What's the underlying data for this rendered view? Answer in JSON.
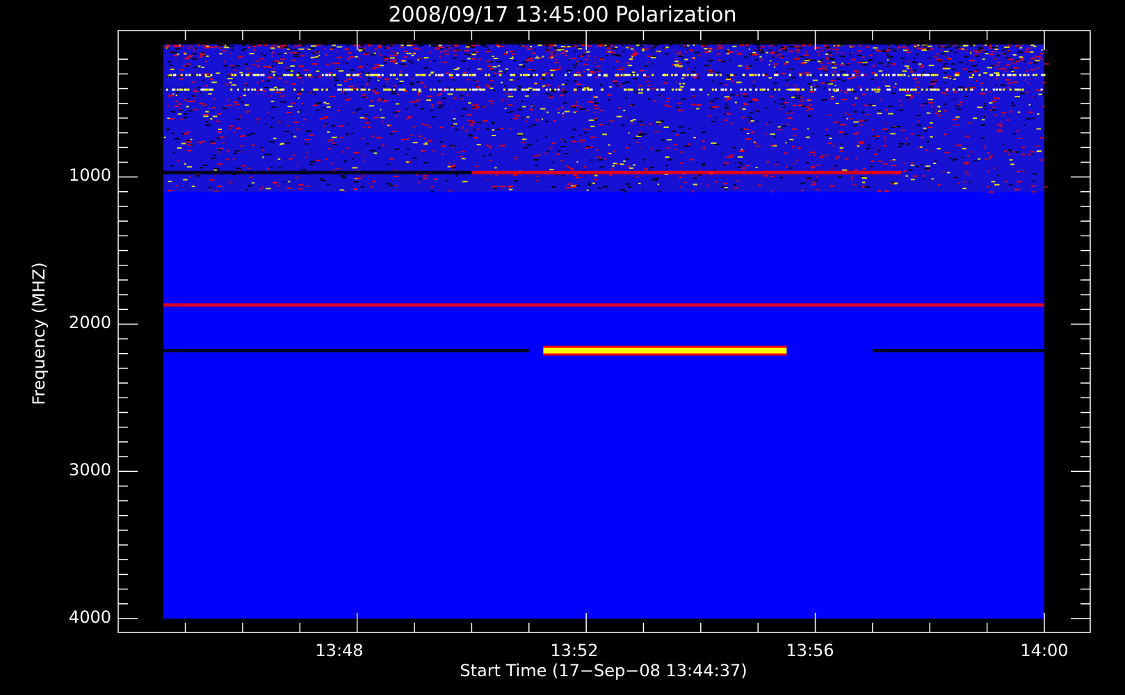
{
  "chart_data": {
    "type": "heatmap",
    "title": "2008/09/17 13:45:00 Polarization",
    "xlabel": "Start Time (17−Sep−08 13:44:37)",
    "ylabel": "Frequency (MHZ)",
    "x_ticks": [
      "13:48",
      "13:52",
      "13:56",
      "14:00"
    ],
    "y_ticks": [
      "1000",
      "2000",
      "3000",
      "4000"
    ],
    "xlim": [
      "13:44:37",
      "14:00:00"
    ],
    "ylim": [
      100,
      4000
    ],
    "y_axis_inverted": true,
    "colormap": {
      "background": "#0000ff",
      "low": "#000000",
      "mid": "#ff0000",
      "high": "#ffff00"
    },
    "features": [
      {
        "label": "noisy band",
        "freq_range": [
          100,
          1100
        ],
        "time_range": [
          "13:44:37",
          "14:00:00"
        ],
        "intensity": "mixed"
      },
      {
        "label": "line",
        "freq": 970,
        "time_range": [
          "13:44:37",
          "13:50:00"
        ],
        "intensity": "low"
      },
      {
        "label": "line",
        "freq": 970,
        "time_range": [
          "13:50:00",
          "13:57:30"
        ],
        "intensity": "mid"
      },
      {
        "label": "line",
        "freq": 1870,
        "time_range": [
          "13:44:37",
          "14:00:00"
        ],
        "intensity": "mid"
      },
      {
        "label": "line",
        "freq": 2180,
        "time_range": [
          "13:44:37",
          "13:51:00"
        ],
        "intensity": "low"
      },
      {
        "label": "burst",
        "freq": 2180,
        "time_range": [
          "13:51:15",
          "13:55:30"
        ],
        "intensity": "high"
      },
      {
        "label": "line",
        "freq": 2180,
        "time_range": [
          "13:57:00",
          "14:00:00"
        ],
        "intensity": "low"
      }
    ]
  }
}
